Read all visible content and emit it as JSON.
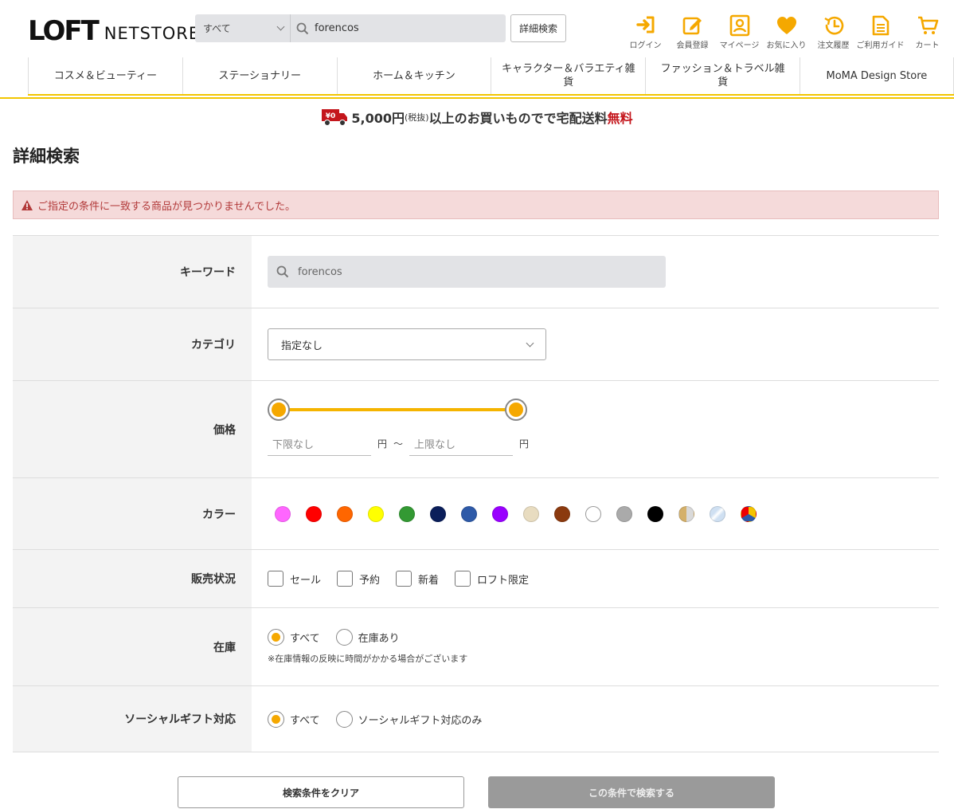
{
  "header": {
    "logo_loft": "LOFT",
    "logo_netstore": "NETSTORE",
    "search": {
      "scope": "すべて",
      "query": "forencos"
    },
    "advanced_search_label": "詳細検索",
    "icons": [
      {
        "label": "ログイン",
        "icon": "login-icon"
      },
      {
        "label": "会員登録",
        "icon": "register-icon"
      },
      {
        "label": "マイページ",
        "icon": "mypage-icon"
      },
      {
        "label": "お気に入り",
        "icon": "heart-icon"
      },
      {
        "label": "注文履歴",
        "icon": "history-icon"
      },
      {
        "label": "ご利用ガイド",
        "icon": "guide-icon"
      },
      {
        "label": "カート",
        "icon": "cart-icon"
      }
    ]
  },
  "nav": [
    {
      "label": "コスメ＆ビューティー"
    },
    {
      "label": "ステーショナリー"
    },
    {
      "label": "ホーム＆キッチン"
    },
    {
      "label": "キャラクター＆バラエティ雑貨"
    },
    {
      "label": "ファッション＆トラベル雑貨"
    },
    {
      "label": "MoMA Design Store"
    }
  ],
  "banner": {
    "truck_badge": "¥0",
    "amount": "5,000円",
    "tax": "(税抜)",
    "middle": "以上のお買いものでで宅配送料",
    "free": "無料"
  },
  "page_title": "詳細検索",
  "alert": "ご指定の条件に一致する商品が見つかりませんでした。",
  "form": {
    "keyword": {
      "label": "キーワード",
      "value": "forencos"
    },
    "category": {
      "label": "カテゴリ",
      "value": "指定なし"
    },
    "price": {
      "label": "価格",
      "min_placeholder": "下限なし",
      "max_placeholder": "上限なし",
      "yen": "円",
      "tilde": "～",
      "range_fraction": [
        0,
        1
      ]
    },
    "color": {
      "label": "カラー",
      "swatches": [
        "#ff66ff",
        "#ff0000",
        "#ff6600",
        "#ffff00",
        "#339933",
        "#0a1e5a",
        "#2e5aa8",
        "#9900ff",
        "#e8dcc0",
        "#8b3a0f",
        "#ffffff",
        "#aaaaaa",
        "#000000",
        "gold",
        "silver",
        "multi"
      ]
    },
    "status": {
      "label": "販売状況",
      "options": [
        "セール",
        "予約",
        "新着",
        "ロフト限定"
      ]
    },
    "stock": {
      "label": "在庫",
      "options": [
        "すべて",
        "在庫あり"
      ],
      "selected": 0,
      "note": "※在庫情報の反映に時間がかかる場合がございます"
    },
    "gift": {
      "label": "ソーシャルギフト対応",
      "options": [
        "すべて",
        "ソーシャルギフト対応のみ"
      ],
      "selected": 0
    }
  },
  "buttons": {
    "clear": "検索条件をクリア",
    "search": "この条件で検索する"
  },
  "colors": {
    "accent": "#f5a800",
    "slider": "#f5b400",
    "nav_border": "#f2c500",
    "alert_bg": "#f5dada",
    "alert_text": "#b23a3a",
    "free_red": "#c4161c"
  }
}
